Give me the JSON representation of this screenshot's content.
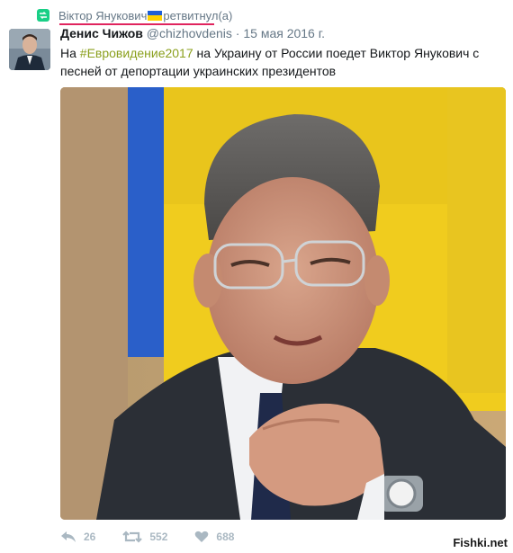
{
  "retweet": {
    "name": "Віктор Янукович",
    "action": "ретвитнул(а)",
    "icon": "retweet-icon",
    "accent_color": "#19cf86",
    "underline_color": "#e0245e",
    "flag_colors": [
      "#1f5fd6",
      "#ffd200"
    ]
  },
  "tweet": {
    "author_name": "Денис Чижов",
    "handle": "@chizhovdenis",
    "separator": "·",
    "date": "15 мая 2016 г.",
    "text_before": "На ",
    "hashtag": "#Евровидение2017",
    "text_after": " на Украину от России поедет Виктор Янукович с песней от депортации украинских президентов",
    "hashtag_color": "#8ba01e"
  },
  "actions": {
    "reply": {
      "icon": "reply-icon",
      "count": "26"
    },
    "retweet": {
      "icon": "retweet-icon",
      "count": "552"
    },
    "like": {
      "icon": "heart-icon",
      "count": "688"
    }
  },
  "watermark": "Fishki.net"
}
